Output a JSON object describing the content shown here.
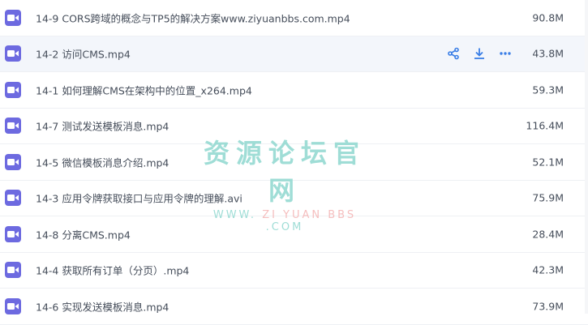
{
  "files": [
    {
      "name": "14-9 CORS跨域的概念与TP5的解决方案www.ziyuanbbs.com.mp4",
      "size": "90.8M"
    },
    {
      "name": "14-2 访问CMS.mp4",
      "size": "43.8M"
    },
    {
      "name": "14-1 如何理解CMS在架构中的位置_x264.mp4",
      "size": "59.3M"
    },
    {
      "name": "14-7 测试发送模板消息.mp4",
      "size": "116.4M"
    },
    {
      "name": "14-5 微信模板消息介绍.mp4",
      "size": "52.1M"
    },
    {
      "name": "14-3 应用令牌获取接口与应用令牌的理解.avi",
      "size": "75.9M"
    },
    {
      "name": "14-8 分离CMS.mp4",
      "size": "28.4M"
    },
    {
      "name": "14-4 获取所有订单（分页）.mp4",
      "size": "42.3M"
    },
    {
      "name": "14-6 实现发送模板消息.mp4",
      "size": "73.9M"
    }
  ],
  "row_actions_icons": [
    "share-icon",
    "download-icon",
    "more-icon"
  ],
  "watermark": {
    "cn": "资源论坛官网",
    "en_left": "WWW.",
    "en_mid": "ZI YUAN BBS",
    "en_right": ".COM"
  },
  "colors": {
    "file_icon": "#6d6ae0",
    "action_icon": "#3a7ee6",
    "hover_row": "#f3f6fb",
    "text": "#454d5a"
  }
}
